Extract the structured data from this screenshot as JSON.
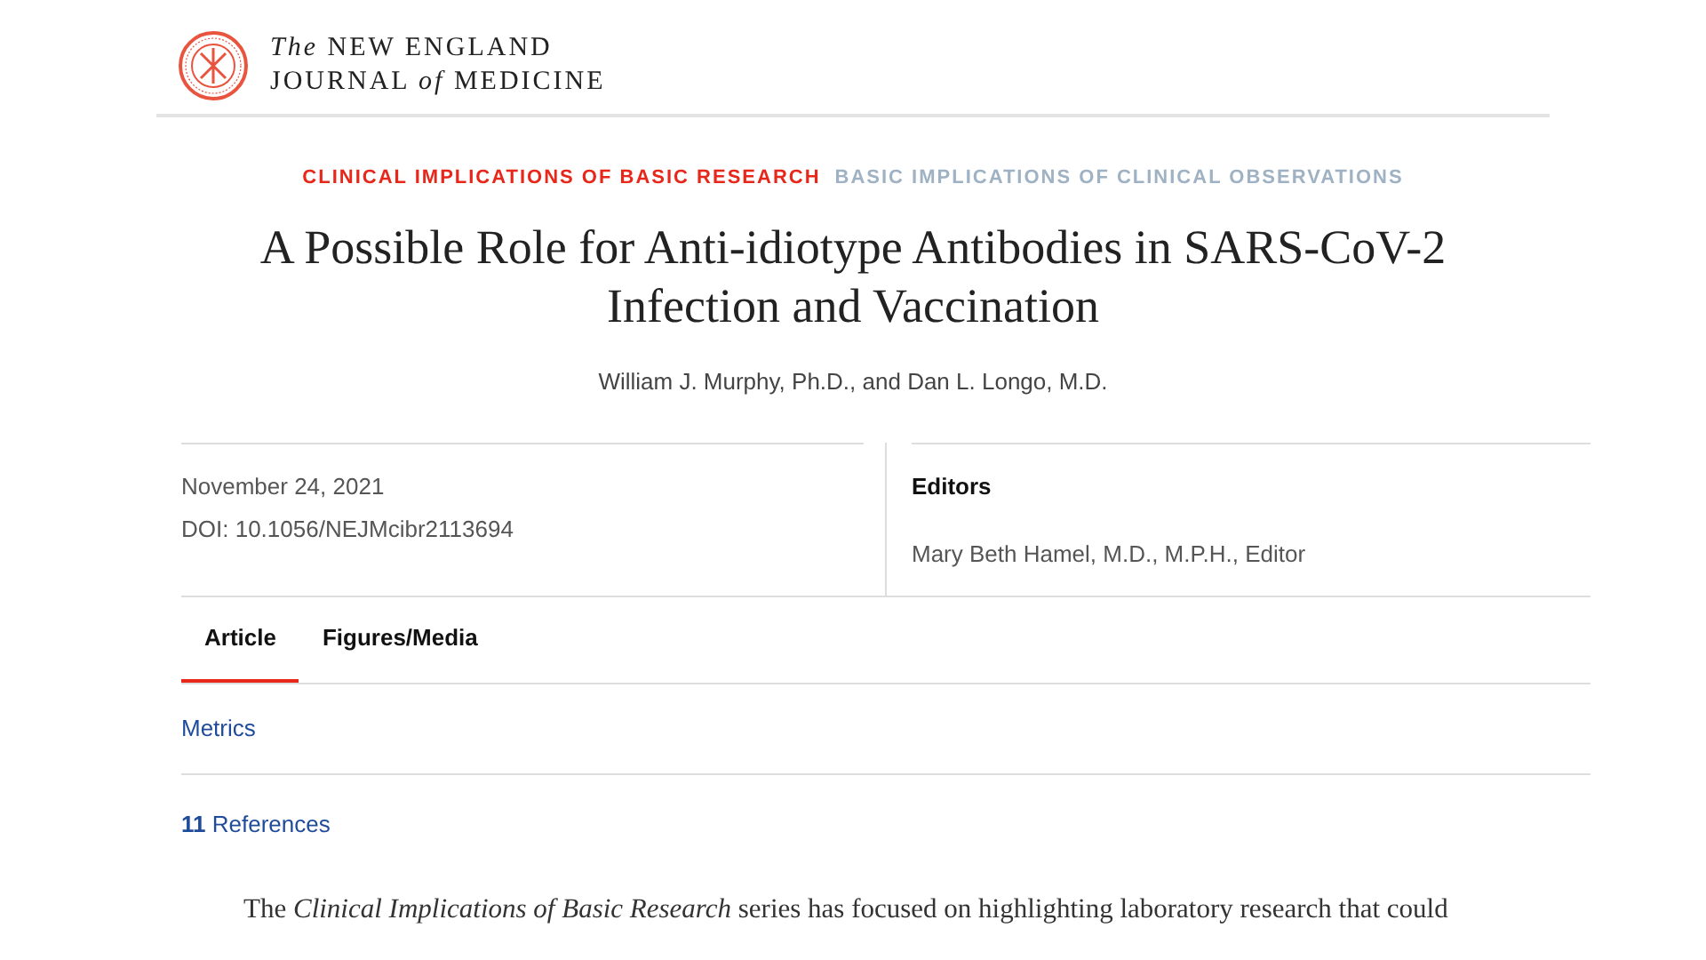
{
  "logo": {
    "line_1": "*The* NEW ENGLAND",
    "line_2": "JOURNAL *of* MEDICINE"
  },
  "categories": [
    {
      "label": "CLINICAL IMPLICATIONS OF BASIC RESEARCH",
      "selected": true
    },
    {
      "label": "BASIC IMPLICATIONS OF CLINICAL OBSERVATIONS",
      "selected": false
    }
  ],
  "title": "A Possible Role for Anti-idiotype Antibodies in SARS-CoV-2 Infection and Vaccination",
  "authors": "William J. Murphy, Ph.D., and Dan L. Longo, M.D.",
  "date": "November 24, 2021",
  "doi": "DOI: 10.1056/NEJMcibr2113694",
  "editors": {
    "heading": "Editors",
    "names": "Mary Beth Hamel, M.D., M.P.H., Editor"
  },
  "tabs": [
    {
      "label": "Article",
      "selected": true
    },
    {
      "label": "Figures/Media",
      "selected": false
    }
  ],
  "metrics_link": "Metrics",
  "references": {
    "count": "11",
    "label": "References"
  },
  "body": "The *Clinical Implications of Basic Research* series has focused on highlighting laboratory research that could"
}
